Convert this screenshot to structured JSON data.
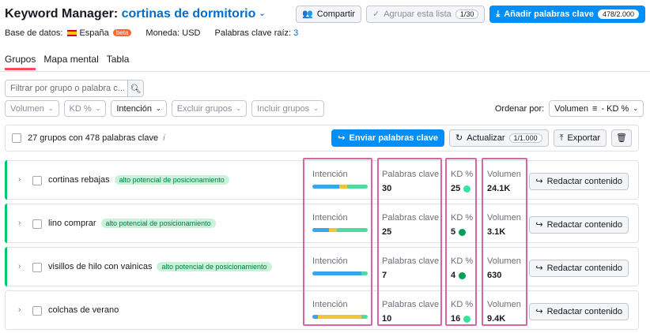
{
  "header": {
    "title_prefix": "Keyword Manager:",
    "title_list": "cortinas de dormitorio",
    "share_label": "Compartir",
    "group_label": "Agrupar esta lista",
    "group_count": "1/30",
    "add_label": "Añadir palabras clave",
    "add_count": "478/2.000"
  },
  "meta": {
    "db_label": "Base de datos:",
    "db_value": "España",
    "db_badge": "beta",
    "currency_label": "Moneda: USD",
    "root_label": "Palabras clave raíz:",
    "root_value": "3"
  },
  "tabs": [
    {
      "label": "Grupos",
      "active": true
    },
    {
      "label": "Mapa mental",
      "active": false
    },
    {
      "label": "Tabla",
      "active": false
    }
  ],
  "filter": {
    "placeholder": "Filtrar por grupo o palabra c..."
  },
  "filters": [
    {
      "label": "Volumen"
    },
    {
      "label": "KD %"
    },
    {
      "label": "Intención"
    },
    {
      "label": "Excluir grupos"
    },
    {
      "label": "Incluir grupos"
    }
  ],
  "order": {
    "label": "Ordenar por:",
    "value": "Volumen",
    "value2": "- KD %"
  },
  "summary": {
    "text": "27 grupos con 478 palabras clave",
    "info": "i",
    "send_label": "Enviar palabras clave",
    "update_label": "Actualizar",
    "update_count": "1/1.000",
    "export_label": "Exportar"
  },
  "columns": {
    "intent": "Intención",
    "keywords": "Palabras clave",
    "kd": "KD %",
    "volume": "Volumen",
    "action": "Redactar contenido"
  },
  "groups": [
    {
      "name": "cortinas rebajas",
      "badge": "alto potencial de posicionamiento",
      "keywords": "30",
      "kd": "25",
      "kd_color": "#37e39b",
      "volume": "24.1K",
      "intent": [
        {
          "share": 0.48,
          "color": "#3aa5e8"
        },
        {
          "share": 0.15,
          "color": "#f4c23b"
        },
        {
          "share": 0.37,
          "color": "#54d8a3"
        }
      ]
    },
    {
      "name": "lino comprar",
      "badge": "alto potencial de posicionamiento",
      "keywords": "25",
      "kd": "5",
      "kd_color": "#009f57",
      "volume": "3.1K",
      "intent": [
        {
          "share": 0.3,
          "color": "#3aa5e8"
        },
        {
          "share": 0.14,
          "color": "#f4c23b"
        },
        {
          "share": 0.56,
          "color": "#54d8a3"
        }
      ]
    },
    {
      "name": "visillos de hilo con vainicas",
      "badge": "alto potencial de posicionamiento",
      "keywords": "7",
      "kd": "4",
      "kd_color": "#009f57",
      "volume": "630",
      "intent": [
        {
          "share": 0.88,
          "color": "#3aa5e8"
        },
        {
          "share": 0.12,
          "color": "#54d8a3"
        }
      ]
    },
    {
      "name": "colchas de verano",
      "badge": "",
      "keywords": "10",
      "kd": "16",
      "kd_color": "#37e39b",
      "volume": "9.4K",
      "intent": [
        {
          "share": 0.1,
          "color": "#3aa5e8"
        },
        {
          "share": 0.78,
          "color": "#f4c23b"
        },
        {
          "share": 0.12,
          "color": "#54d8a3"
        }
      ]
    }
  ]
}
